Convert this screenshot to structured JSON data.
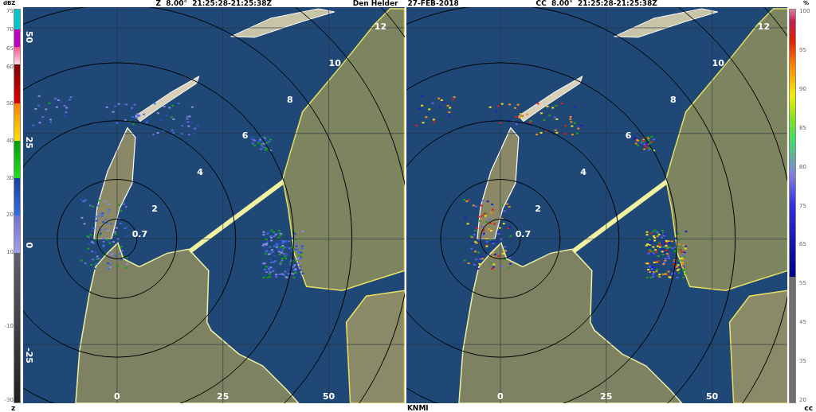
{
  "header": {
    "title_left": "Z  8.00°  21:25:28-21:25:38Z",
    "station": "Den Helder",
    "date": "27-FEB-2018",
    "title_right": "CC  8.00°  21:25:28-21:25:38Z"
  },
  "colorbar_z": {
    "unit": "dBZ",
    "label": "z",
    "ticks": [
      "75",
      "70",
      "65",
      "60",
      "50",
      "40",
      "30",
      "20",
      "10",
      "-10",
      "-30"
    ]
  },
  "colorbar_cc": {
    "unit": "%",
    "label": "cc",
    "ticks": [
      "100",
      "95",
      "90",
      "85",
      "80",
      "75",
      "65",
      "55",
      "45",
      "35",
      "20"
    ]
  },
  "panels": [
    {
      "kind": "z",
      "ring_labels": [
        "0.7",
        "2",
        "4",
        "6",
        "8",
        "10",
        "12"
      ],
      "y_axis": [
        "50",
        "25",
        "0",
        "-25"
      ],
      "x_axis": [
        "0",
        "25",
        "50"
      ]
    },
    {
      "kind": "cc",
      "ring_labels": [
        "0.7",
        "2",
        "4",
        "6",
        "8",
        "10",
        "12"
      ],
      "x_axis": [
        "0",
        "25",
        "50"
      ]
    }
  ],
  "footer": {
    "credit": "KNMI"
  }
}
